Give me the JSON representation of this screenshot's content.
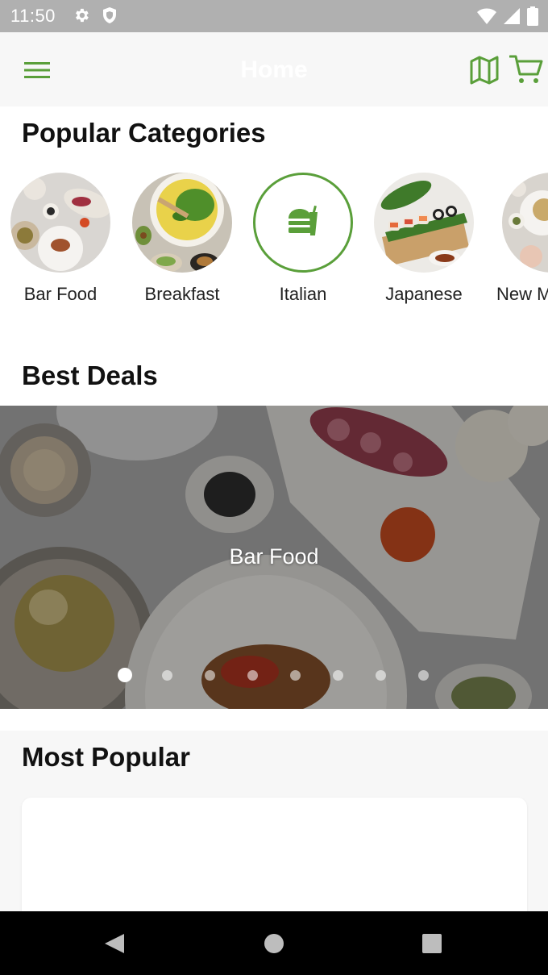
{
  "status_bar": {
    "time": "11:50",
    "left_icons": [
      "gear-icon",
      "shield-icon"
    ],
    "right_icons": [
      "wifi-icon",
      "cell-signal-icon",
      "battery-icon"
    ]
  },
  "app_bar": {
    "title": "Home",
    "menu_icon": "hamburger-menu-icon",
    "actions": [
      "map-icon",
      "cart-icon"
    ],
    "accent_color": "#5a9f3a"
  },
  "popular_categories": {
    "title": "Popular Categories",
    "items": [
      {
        "label": "Bar Food",
        "selected": false
      },
      {
        "label": "Breakfast",
        "selected": false
      },
      {
        "label": "Italian",
        "selected": true,
        "icon": "fastfood-icon"
      },
      {
        "label": "Japanese",
        "selected": false
      },
      {
        "label": "New M",
        "selected": false
      }
    ]
  },
  "best_deals": {
    "title": "Best Deals",
    "banner_label": "Bar Food",
    "carousel_pages": 8,
    "current_page": 1
  },
  "most_popular": {
    "title": "Most Popular"
  },
  "nav_bar": {
    "buttons": [
      "back-icon",
      "home-icon",
      "recents-icon"
    ]
  }
}
